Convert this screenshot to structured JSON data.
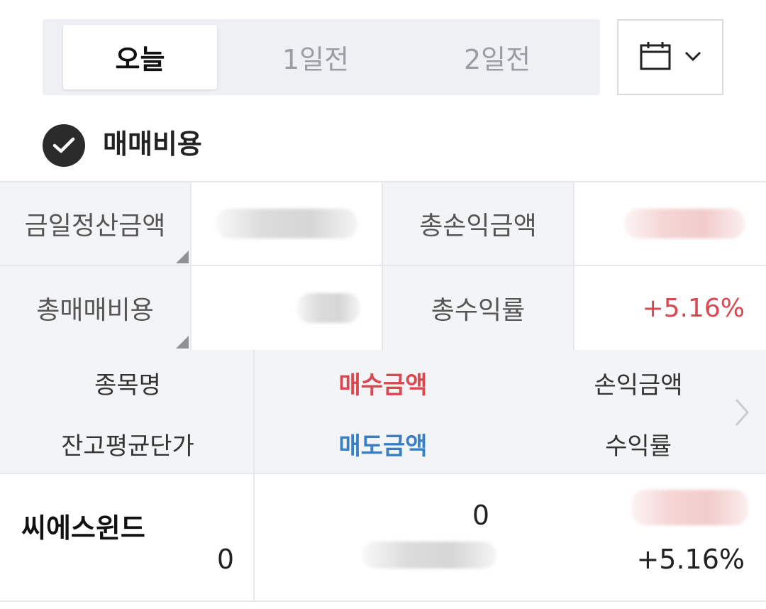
{
  "date_tabs": [
    {
      "label": "오늘",
      "active": true
    },
    {
      "label": "1일전",
      "active": false
    },
    {
      "label": "2일전",
      "active": false
    }
  ],
  "calendar_button": {
    "icon": "calendar-icon",
    "dropdown_icon": "chevron-down-icon"
  },
  "section": {
    "title": "매매비용",
    "checked": true
  },
  "summary": {
    "settlement_label": "금일정산금액",
    "settlement_value": "",
    "total_pnl_label": "총손익금액",
    "total_pnl_value": "",
    "total_cost_label": "총매매비용",
    "total_cost_value": "",
    "total_return_label": "총수익률",
    "total_return_value": "+5.16%"
  },
  "columns": {
    "stock_name": "종목명",
    "buy_amount": "매수금액",
    "pnl_amount": "손익금액",
    "avg_price": "잔고평균단가",
    "sell_amount": "매도금액",
    "return_rate": "수익률"
  },
  "rows": [
    {
      "name": "씨에스윈드",
      "avg_price": "0",
      "buy_amount": "0",
      "sell_amount": "",
      "pnl_amount": "",
      "return_rate": "+5.16%"
    }
  ],
  "colors": {
    "positive": "#d9474f",
    "sell": "#3a7fc4",
    "label_bg": "#f3f4f6",
    "tab_bg": "#eef0f3"
  }
}
